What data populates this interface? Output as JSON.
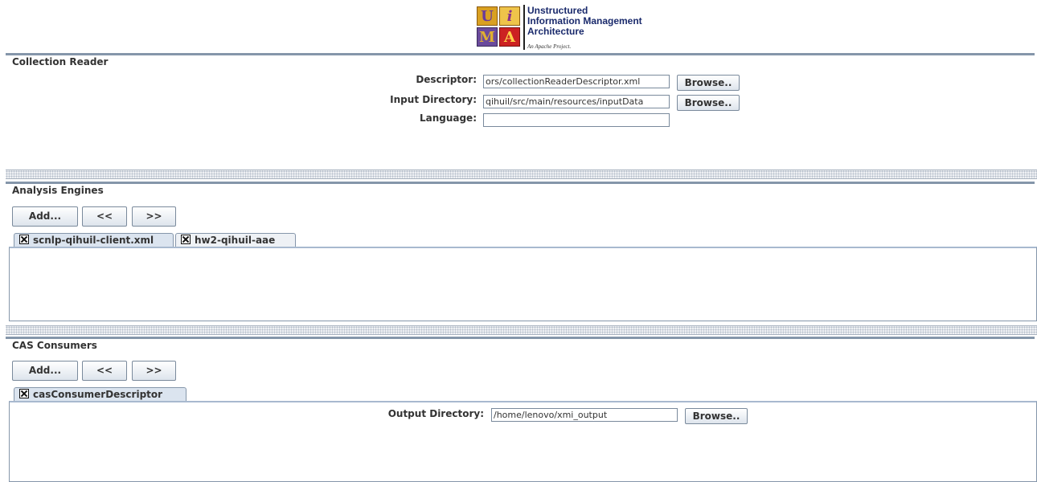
{
  "header": {
    "logo_letters": [
      "U",
      "i",
      "M",
      "A"
    ],
    "logo_lines": [
      "Unstructured",
      "Information Management",
      "Architecture"
    ],
    "logo_tagline": "An Apache Project."
  },
  "collection_reader": {
    "title": "Collection Reader",
    "descriptor_label": "Descriptor:",
    "descriptor_value": "ors/collectionReaderDescriptor.xml",
    "input_dir_label": "Input Directory:",
    "input_dir_value": "qihuil/src/main/resources/inputData",
    "language_label": "Language:",
    "language_value": "",
    "browse_label": "Browse.."
  },
  "analysis_engines": {
    "title": "Analysis Engines",
    "add_label": "Add...",
    "left_label": "<<",
    "right_label": ">>",
    "tabs": [
      {
        "label": "scnlp-qihuil-client.xml"
      },
      {
        "label": "hw2-qihuil-aae"
      }
    ]
  },
  "cas_consumers": {
    "title": "CAS Consumers",
    "add_label": "Add...",
    "left_label": "<<",
    "right_label": ">>",
    "tabs": [
      {
        "label": "casConsumerDescriptor"
      }
    ],
    "output_dir_label": "Output Directory:",
    "output_dir_value": "/home/lenovo/xmi_output",
    "browse_label": "Browse.."
  },
  "colors": {
    "section_border": "#8596aa",
    "logo_text": "#1a2a6c",
    "tile_orange": "#e0a020",
    "tile_purple": "#5b3f8c",
    "tile_red": "#c81e1e"
  }
}
